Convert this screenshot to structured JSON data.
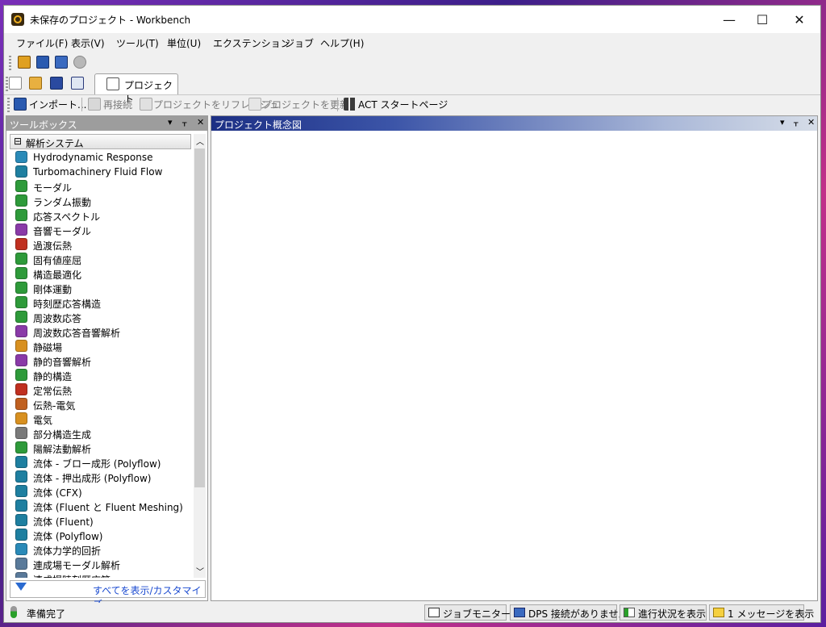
{
  "window": {
    "title": "未保存のプロジェクト - Workbench",
    "minimize": "—",
    "maximize": "☐",
    "close": "✕"
  },
  "menu": [
    "ファイル(F)",
    "表示(V)",
    "ツール(T)",
    "単位(U)",
    "エクステンション",
    "ジョブ",
    "ヘルプ(H)"
  ],
  "project_tab": {
    "label": "プロジェクト"
  },
  "toolbar": {
    "import": "インポート...",
    "reconnect": "再接続",
    "refresh": "プロジェクトをリフレッシュ",
    "update": "プロジェクトを更新",
    "act": "ACT スタートページ"
  },
  "toolbox": {
    "title": "ツールボックス",
    "pin": "ᚁ",
    "dropdown": "▾",
    "close": "✕",
    "group": {
      "toggle": "⊟",
      "label": "解析システム"
    },
    "items": [
      {
        "label": "Hydrodynamic Response",
        "icon": "hydrodynamic-icon",
        "color": "#2a8ab8"
      },
      {
        "label": "Turbomachinery Fluid Flow",
        "icon": "turbo-icon",
        "color": "#1e7fa0"
      },
      {
        "label": "モーダル",
        "icon": "modal-icon",
        "color": "#2e9a3a"
      },
      {
        "label": "ランダム振動",
        "icon": "random-vibration-icon",
        "color": "#2e9a3a"
      },
      {
        "label": "応答スペクトル",
        "icon": "response-spectrum-icon",
        "color": "#2e9a3a"
      },
      {
        "label": "音響モーダル",
        "icon": "acoustic-modal-icon",
        "color": "#8a3aa8"
      },
      {
        "label": "過渡伝熱",
        "icon": "transient-thermal-icon",
        "color": "#c03020"
      },
      {
        "label": "固有値座屈",
        "icon": "buckling-icon",
        "color": "#2e9a3a"
      },
      {
        "label": "構造最適化",
        "icon": "topology-icon",
        "color": "#2e9a3a"
      },
      {
        "label": "剛体運動",
        "icon": "rigid-body-icon",
        "color": "#2e9a3a"
      },
      {
        "label": "時刻歴応答構造",
        "icon": "transient-structural-icon",
        "color": "#2e9a3a"
      },
      {
        "label": "周波数応答",
        "icon": "harmonic-icon",
        "color": "#2e9a3a"
      },
      {
        "label": "周波数応答音響解析",
        "icon": "harmonic-acoustics-icon",
        "color": "#8a3aa8"
      },
      {
        "label": "静磁場",
        "icon": "magnetostatic-icon",
        "color": "#d89020"
      },
      {
        "label": "静的音響解析",
        "icon": "static-acoustics-icon",
        "color": "#8a3aa8"
      },
      {
        "label": "静的構造",
        "icon": "static-structural-icon",
        "color": "#2e9a3a"
      },
      {
        "label": "定常伝熱",
        "icon": "steady-thermal-icon",
        "color": "#c03020"
      },
      {
        "label": "伝熱-電気",
        "icon": "thermal-electric-icon",
        "color": "#c06020"
      },
      {
        "label": "電気",
        "icon": "electric-icon",
        "color": "#d89020"
      },
      {
        "label": "部分構造生成",
        "icon": "substructure-icon",
        "color": "#7a7a7a"
      },
      {
        "label": "陽解法動解析",
        "icon": "explicit-dynamics-icon",
        "color": "#2e9a3a"
      },
      {
        "label": "流体 - ブロー成形 (Polyflow)",
        "icon": "polyflow-blow-icon",
        "color": "#1e7fa0"
      },
      {
        "label": "流体 - 押出成形 (Polyflow)",
        "icon": "polyflow-extrusion-icon",
        "color": "#1e7fa0"
      },
      {
        "label": "流体 (CFX)",
        "icon": "cfx-icon",
        "color": "#1e7fa0"
      },
      {
        "label": "流体 (Fluent と Fluent Meshing)",
        "icon": "fluent-meshing-icon",
        "color": "#1e7fa0"
      },
      {
        "label": "流体 (Fluent)",
        "icon": "fluent-icon",
        "color": "#1e7fa0"
      },
      {
        "label": "流体 (Polyflow)",
        "icon": "polyflow-icon",
        "color": "#1e7fa0"
      },
      {
        "label": "流体力学的回折",
        "icon": "hydrodynamic-diffraction-icon",
        "color": "#2a8ab8"
      },
      {
        "label": "連成場モーダル解析",
        "icon": "coupled-modal-icon",
        "color": "#5a7a9a"
      },
      {
        "label": "連成場時刻歴応答",
        "icon": "coupled-transient-icon",
        "color": "#5a7a9a"
      }
    ],
    "filter_link": "すべてを表示/カスタマイズ..."
  },
  "schematic": {
    "title": "プロジェクト概念図"
  },
  "status": {
    "ready": "準備完了",
    "job_monitor": "ジョブモニター...",
    "dps": "DPS 接続がありません",
    "progress": "進行状況を表示",
    "messages": "1 メッセージを表示"
  }
}
